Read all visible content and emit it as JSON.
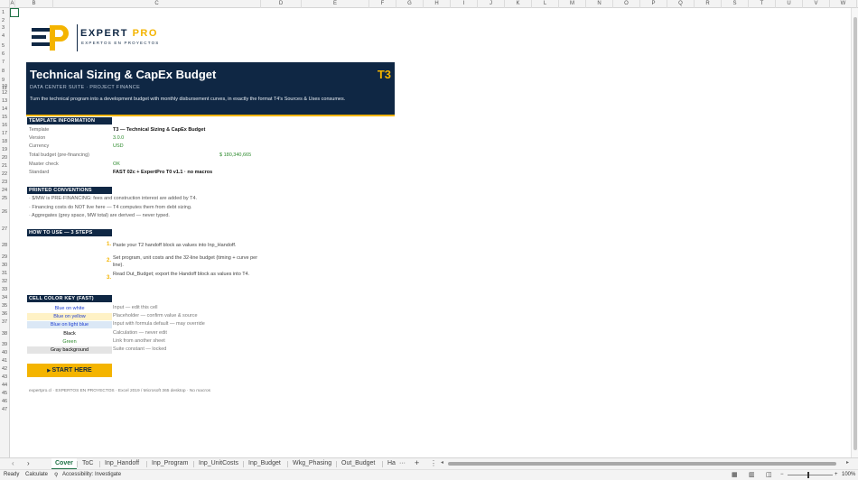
{
  "columns": [
    "A",
    "B",
    "C",
    "D",
    "E",
    "F",
    "G",
    "H",
    "I",
    "J",
    "K",
    "L",
    "M",
    "N",
    "O",
    "P",
    "Q",
    "R",
    "S",
    "T",
    "U",
    "V",
    "W",
    "X"
  ],
  "rows": [
    "1",
    "2",
    "3",
    "4",
    "5",
    "6",
    "7",
    "8",
    "9",
    "10",
    "11",
    "12",
    "13",
    "14",
    "15",
    "16",
    "17",
    "18",
    "19",
    "20",
    "21",
    "22",
    "23",
    "24",
    "25",
    "26",
    "27",
    "28",
    "29",
    "30",
    "31",
    "32",
    "33",
    "34",
    "35",
    "36",
    "37",
    "38",
    "39",
    "40",
    "41",
    "42",
    "43",
    "44",
    "45",
    "46",
    "47"
  ],
  "logo": {
    "name": "EXPERT",
    "name_accent": "PRO",
    "tagline": "EXPERTOS EN PROYECTOS"
  },
  "banner": {
    "title": "Technical Sizing & CapEx Budget",
    "code": "T3",
    "subtitle": "DATA CENTER SUITE · PROJECT FINANCE",
    "description": "Turn the technical program into a development budget with monthly disbursement curves, in exactly the format T4's Sources & Uses consumes."
  },
  "template_info": {
    "header": "TEMPLATE INFORMATION",
    "rows": [
      {
        "label": "Template",
        "value": "T3 — Technical Sizing & CapEx Budget"
      },
      {
        "label": "Version",
        "value": "3.0.0"
      },
      {
        "label": "Currency",
        "value": "USD"
      },
      {
        "label": "Total budget (pre-financing)",
        "value": "$ 180,340,665"
      },
      {
        "label": "Master check",
        "value": "OK"
      },
      {
        "label": "Standard",
        "value": "FAST 02c + ExpertPro T0 v1.1 · no macros"
      }
    ]
  },
  "conventions": {
    "header": "PRINTED CONVENTIONS",
    "items": [
      "· $/MW is PRE-FINANCING: fees and construction interest are added by T4.",
      "· Financing costs do NOT live here — T4 computes them from debt sizing.",
      "· Aggregates (grey space, MW total) are derived — never typed."
    ]
  },
  "howto": {
    "header": "HOW TO USE — 3 STEPS",
    "steps": [
      {
        "n": "1.",
        "text": "Paste your T2 handoff block as values into Inp_Handoff."
      },
      {
        "n": "2.",
        "text": "Set program, unit costs and the 32-line budget (timing + curve per line)."
      },
      {
        "n": "3.",
        "text": "Read Out_Budget; export the Handoff block as values into T4."
      }
    ]
  },
  "colorkey": {
    "header": "CELL COLOR KEY (FAST)",
    "items": [
      {
        "label": "Blue on white",
        "desc": "Input — edit this cell"
      },
      {
        "label": "Blue on yellow",
        "desc": "Placeholder — confirm value & source"
      },
      {
        "label": "Blue on light blue",
        "desc": "Input with formula default — may override"
      },
      {
        "label": "Black",
        "desc": "Calculation — never edit"
      },
      {
        "label": "Green",
        "desc": "Link from another sheet"
      },
      {
        "label": "Gray background",
        "desc": "Suite constant — locked"
      }
    ]
  },
  "start_button": "START HERE",
  "footer": "expertpro.cl · EXPERTOS EN PROYECTOS · Excel 2019 / Microsoft 365 desktop · No macros",
  "tabs": [
    "Cover",
    "ToC",
    "Inp_Handoff",
    "Inp_Program",
    "Inp_UnitCosts",
    "Inp_Budget",
    "Wkg_Phasing",
    "Out_Budget",
    "Ha"
  ],
  "tab_more": "···",
  "status": {
    "ready": "Ready",
    "calculate": "Calculate",
    "accessibility": "Accessibility: Investigate",
    "zoom": "100%"
  },
  "colors": {
    "navy": "#0f2744",
    "gold": "#f4b400",
    "green": "#1e7145"
  }
}
